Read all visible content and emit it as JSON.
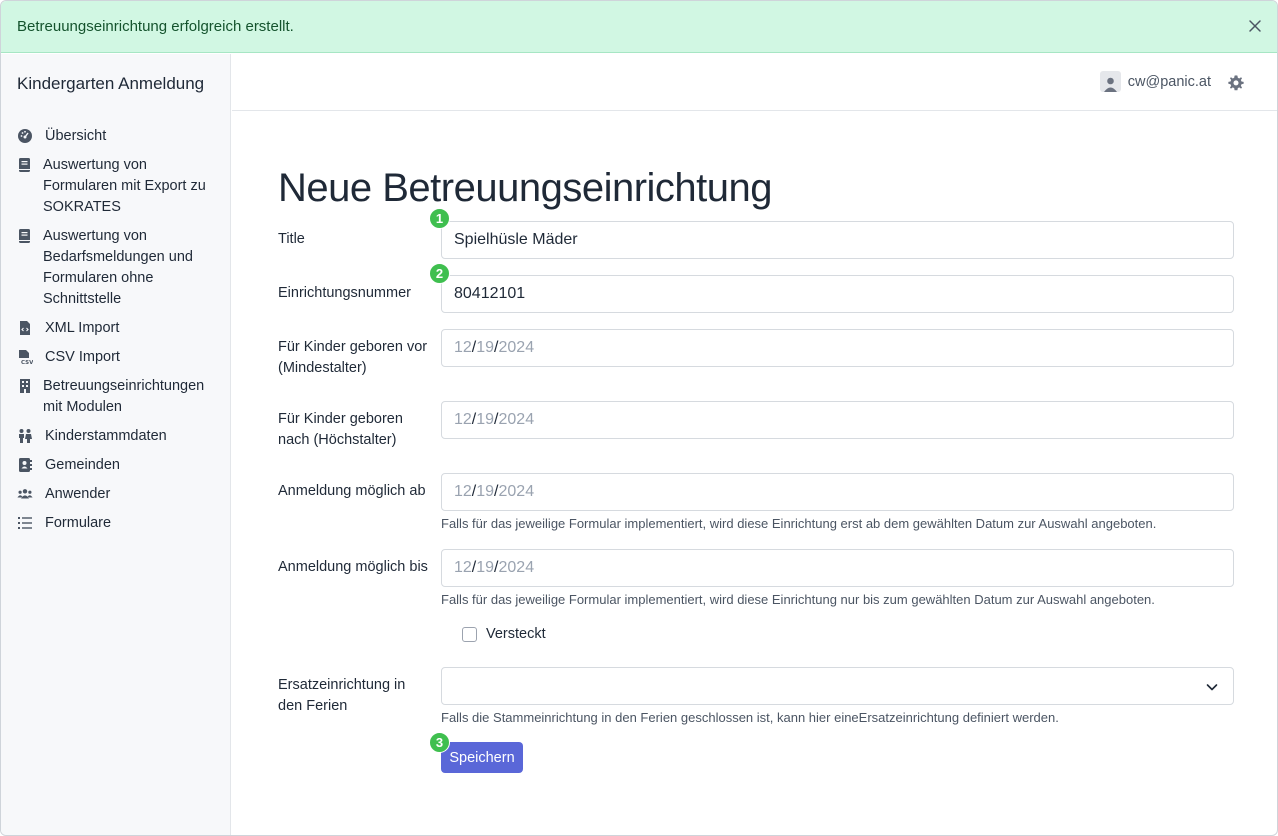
{
  "alert": {
    "message": "Betreuungseinrichtung erfolgreich erstellt."
  },
  "sidebar": {
    "brand": "Kindergarten Anmeldung",
    "items": [
      {
        "label": "Übersicht",
        "icon": "dashboard-icon"
      },
      {
        "label": "Auswertung von Formularen mit Export zu SOKRATES",
        "icon": "book-icon"
      },
      {
        "label": "Auswertung von Bedarfsmeldungen und Formularen ohne Schnittstelle",
        "icon": "book-icon"
      },
      {
        "label": "XML Import",
        "icon": "xml-file-icon"
      },
      {
        "label": "CSV Import",
        "icon": "csv-file-icon"
      },
      {
        "label": "Betreuungseinrichtungen mit Modulen",
        "icon": "building-icon"
      },
      {
        "label": "Kinderstammdaten",
        "icon": "children-icon"
      },
      {
        "label": "Gemeinden",
        "icon": "address-book-icon"
      },
      {
        "label": "Anwender",
        "icon": "users-icon"
      },
      {
        "label": "Formulare",
        "icon": "list-icon"
      }
    ]
  },
  "header": {
    "user_email": "cw@panic.at"
  },
  "form": {
    "title": "Neue Betreuungseinrichtung",
    "fields": {
      "title": {
        "label": "Title",
        "value": "Spielhüsle Mäder"
      },
      "number": {
        "label": "Einrichtungsnummer",
        "value": "80412101"
      },
      "min_age": {
        "label": "Für Kinder geboren vor (Mindestalter)",
        "month": "12",
        "day": "19",
        "year": "2024"
      },
      "max_age": {
        "label": "Für Kinder geboren nach (Höchstalter)",
        "month": "12",
        "day": "19",
        "year": "2024"
      },
      "reg_from": {
        "label": "Anmeldung möglich ab",
        "month": "12",
        "day": "19",
        "year": "2024",
        "help": "Falls für das jeweilige Formular implementiert, wird diese Einrichtung erst ab dem gewählten Datum zur Auswahl angeboten."
      },
      "reg_until": {
        "label": "Anmeldung möglich bis",
        "month": "12",
        "day": "19",
        "year": "2024",
        "help": "Falls für das jeweilige Formular implementiert, wird diese Einrichtung nur bis zum gewählten Datum zur Auswahl angeboten."
      },
      "hidden": {
        "label": "Versteckt",
        "checked": false
      },
      "substitute": {
        "label": "Ersatzeinrichtung in den Ferien",
        "value": "",
        "help": "Falls die Stammeinrichtung in den Ferien geschlossen ist, kann hier eineErsatzeinrichtung definiert werden."
      }
    },
    "save_label": "Speichern"
  },
  "markers": [
    "1",
    "2",
    "3"
  ],
  "colors": {
    "accent": "#5a67d8",
    "alert_bg": "#d1f7e3",
    "marker": "#3fbf4f"
  }
}
